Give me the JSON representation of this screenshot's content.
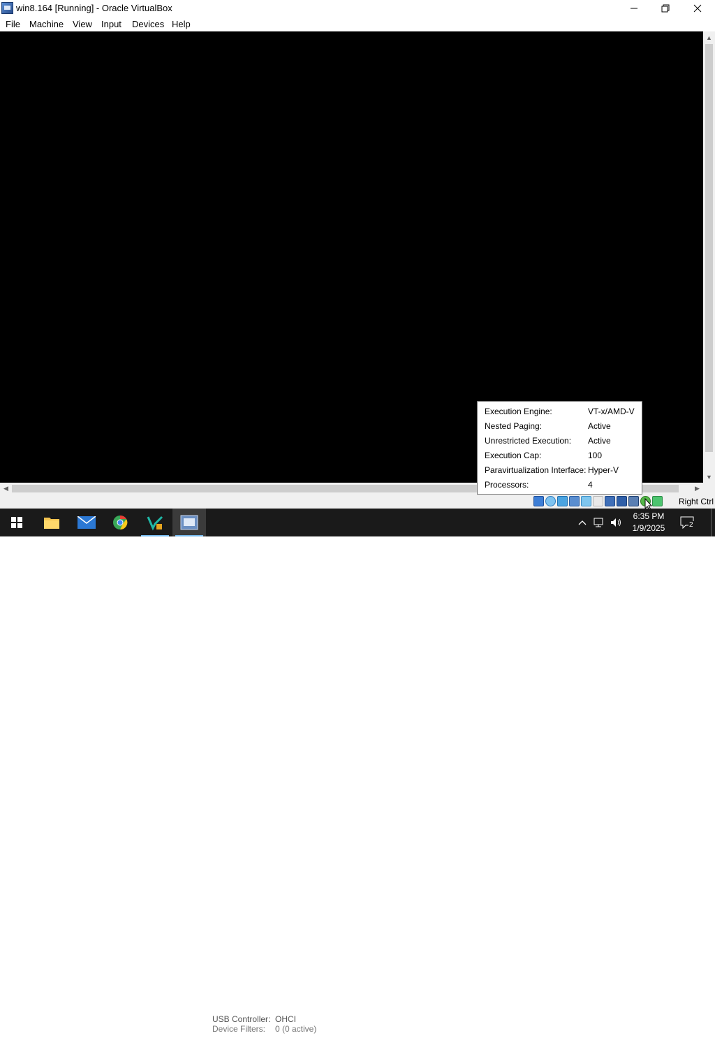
{
  "window": {
    "title": "win8.164 [Running] - Oracle VirtualBox",
    "icons": {
      "app": "virtualbox-icon",
      "minimize": "minimize-icon",
      "maximize": "restore-icon",
      "close": "close-icon"
    }
  },
  "menubar": {
    "items": [
      {
        "label": "File"
      },
      {
        "label": "Machine"
      },
      {
        "label": "View"
      },
      {
        "label": "Input"
      },
      {
        "label": "Devices"
      },
      {
        "label": "Help"
      }
    ]
  },
  "tooltip": {
    "rows": [
      {
        "key": "Execution Engine:",
        "value": "VT-x/AMD-V"
      },
      {
        "key": "Nested Paging:",
        "value": "Active"
      },
      {
        "key": "Unrestricted Execution:",
        "value": "Active"
      },
      {
        "key": "Execution Cap:",
        "value": "100"
      },
      {
        "key": "Paravirtualization Interface:",
        "value": "Hyper-V"
      },
      {
        "key": "Processors:",
        "value": "4"
      }
    ]
  },
  "statusbar": {
    "host_key": "Right Ctrl",
    "icons": [
      "hard-disk-icon",
      "optical-drive-icon",
      "audio-icon",
      "network-icon",
      "usb-icon",
      "shared-folders-icon",
      "display-icon",
      "recording-icon",
      "cpu-icon",
      "mouse-integration-icon",
      "keyboard-icon"
    ]
  },
  "background_window": {
    "line1_label": "USB Controller:",
    "line1_value": "OHCI",
    "line2_label": "Device Filters:",
    "line2_value": "0 (0 active)"
  },
  "taskbar": {
    "apps": [
      "start-button",
      "file-explorer-icon",
      "mail-icon",
      "chrome-icon",
      "vs-code-icon",
      "virtualbox-icon"
    ],
    "clock_time": "6:35 PM",
    "clock_date": "1/9/2025",
    "notification_count": "2"
  },
  "colors": {
    "vm_bg": "#000000",
    "taskbar_bg": "#1a1a1a",
    "accent": "#76b9ed"
  }
}
